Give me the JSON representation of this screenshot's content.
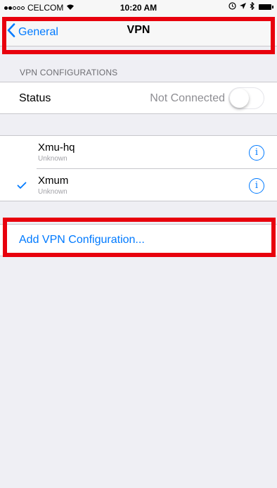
{
  "status_bar": {
    "carrier": "CELCOM",
    "time": "10:20 AM",
    "signal_dots_filled": 2,
    "signal_dots_total": 5
  },
  "nav": {
    "back_label": "General",
    "title": "VPN"
  },
  "section_header": "VPN CONFIGURATIONS",
  "status_row": {
    "label": "Status",
    "value": "Not Connected",
    "toggle_on": false
  },
  "configurations": [
    {
      "name": "Xmu-hq",
      "status": "Unknown",
      "selected": false
    },
    {
      "name": "Xmum",
      "status": "Unknown",
      "selected": true
    }
  ],
  "add_configuration_label": "Add VPN Configuration...",
  "colors": {
    "accent": "#007aff",
    "highlight_box": "#e8000d",
    "background": "#efeff4"
  },
  "icons": [
    "wifi-icon",
    "alarm-icon",
    "location-icon",
    "bluetooth-icon",
    "battery-icon",
    "chevron-left-icon",
    "checkmark-icon",
    "info-icon"
  ]
}
